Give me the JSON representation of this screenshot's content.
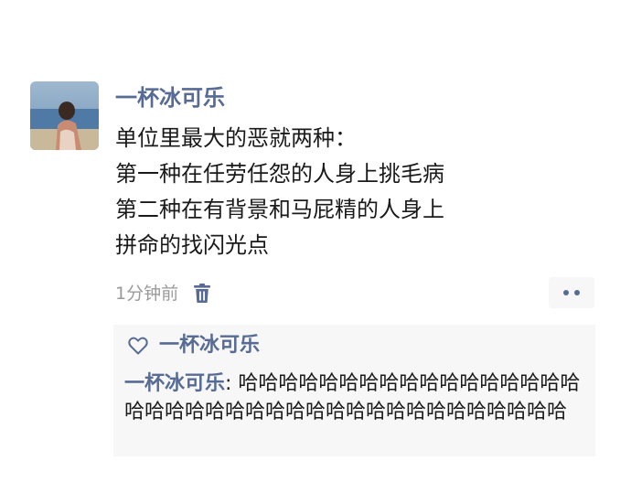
{
  "post": {
    "author_name": "一杯冰可乐",
    "content_lines": [
      "单位里最大的恶就两种：",
      "第一种在任劳任怨的人身上挑毛病",
      "第二种在有背景和马屁精的人身上",
      "拼命的找闪光点"
    ],
    "timestamp": "1分钟前"
  },
  "likes": {
    "names": "一杯冰可乐"
  },
  "comments": [
    {
      "author": "一杯冰可乐",
      "separator": ": ",
      "text": "哈哈哈哈哈哈哈哈哈哈哈哈哈哈哈哈哈哈哈哈哈哈哈哈哈哈哈哈哈哈哈哈哈哈哈哈哈哈哈"
    }
  ],
  "colors": {
    "link_blue": "#576b95",
    "text_dark": "#1a1a1a",
    "text_gray": "#9a9a9a",
    "comment_bg": "#f7f7f7"
  },
  "icons": {
    "avatar": "avatar-photo",
    "delete": "trash-icon",
    "more": "more-dots-icon",
    "like": "heart-icon"
  }
}
